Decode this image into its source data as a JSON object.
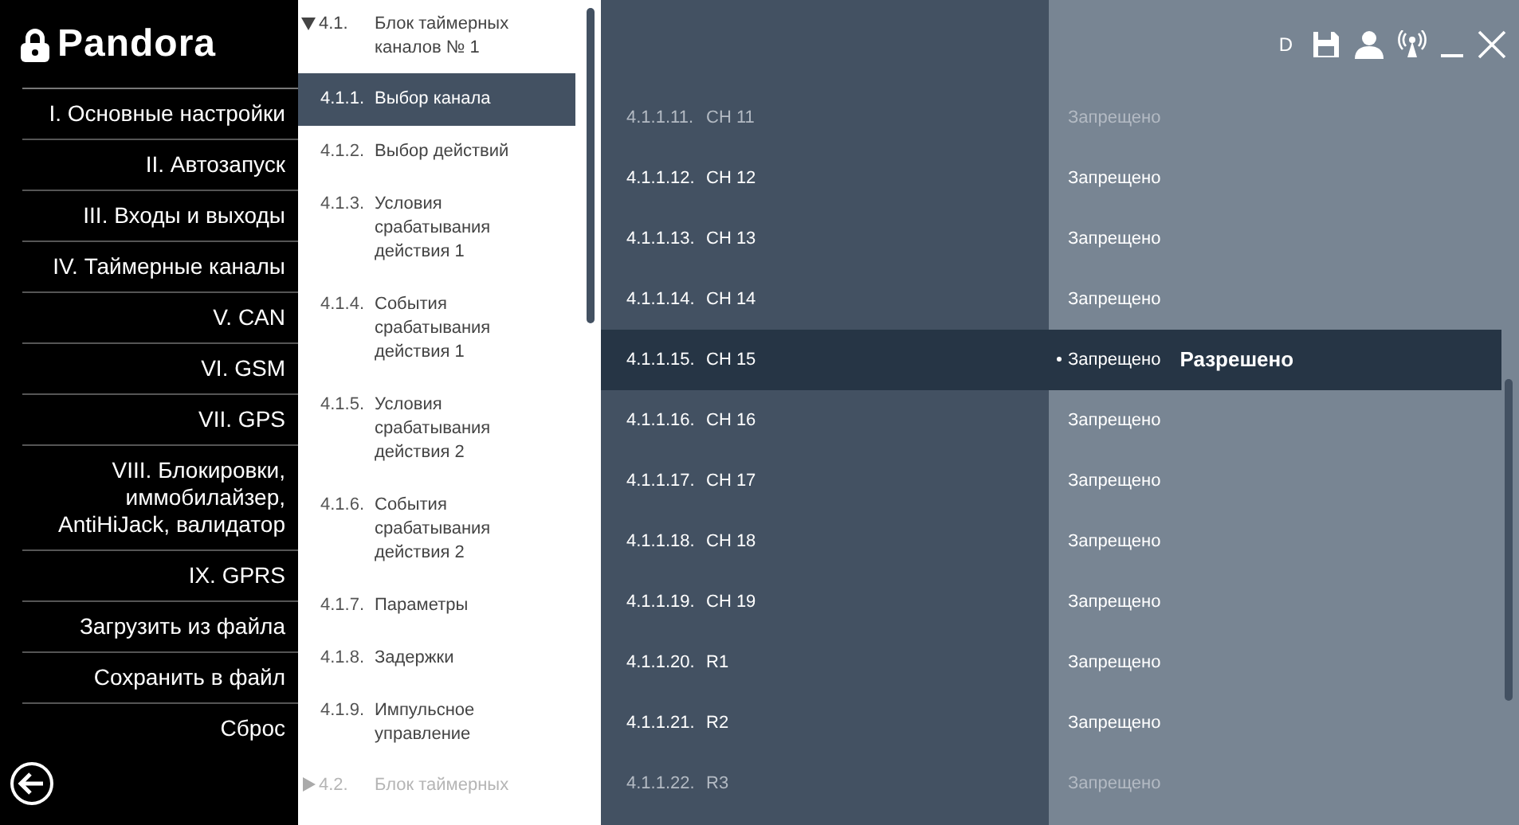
{
  "brand": {
    "name": "Pandora"
  },
  "sidebar": {
    "items": [
      {
        "label": "I. Основные настройки"
      },
      {
        "label": "II. Автозапуск"
      },
      {
        "label": "III. Входы и выходы"
      },
      {
        "label": "IV. Таймерные каналы"
      },
      {
        "label": "V. CAN"
      },
      {
        "label": "VI. GSM"
      },
      {
        "label": "VII. GPS"
      },
      {
        "label": "VIII. Блокировки, иммобилайзер, AntiHiJack, валидатор"
      },
      {
        "label": "IX. GPRS"
      },
      {
        "label": "Загрузить из файла"
      },
      {
        "label": "Сохранить в файл"
      },
      {
        "label": "Сброс"
      }
    ]
  },
  "tree": [
    {
      "number": "4.1.",
      "label": "Блок таймерных каналов № 1",
      "expanded": true,
      "faded": false,
      "children": [
        {
          "number": "4.1.1.",
          "label": "Выбор канала",
          "selected": true
        },
        {
          "number": "4.1.2.",
          "label": "Выбор действий",
          "selected": false
        },
        {
          "number": "4.1.3.",
          "label": "Условия срабатывания действия 1",
          "selected": false
        },
        {
          "number": "4.1.4.",
          "label": "События срабатывания действия 1",
          "selected": false
        },
        {
          "number": "4.1.5.",
          "label": "Условия срабатывания действия 2",
          "selected": false
        },
        {
          "number": "4.1.6.",
          "label": "События срабатывания действия 2",
          "selected": false
        },
        {
          "number": "4.1.7.",
          "label": "Параметры",
          "selected": false
        },
        {
          "number": "4.1.8.",
          "label": "Задержки",
          "selected": false
        },
        {
          "number": "4.1.9.",
          "label": "Импульсное управление",
          "selected": false
        }
      ]
    },
    {
      "number": "4.2.",
      "label": "Блок таймерных",
      "expanded": false,
      "faded": true
    }
  ],
  "title_bar": {
    "mode": "D"
  },
  "channels": [
    {
      "number": "4.1.1.11.",
      "name": "CH 11",
      "value": "Запрещено",
      "selected": false,
      "faded": true
    },
    {
      "number": "4.1.1.12.",
      "name": "CH 12",
      "value": "Запрещено",
      "selected": false,
      "faded": false
    },
    {
      "number": "4.1.1.13.",
      "name": "CH 13",
      "value": "Запрещено",
      "selected": false,
      "faded": false
    },
    {
      "number": "4.1.1.14.",
      "name": "CH 14",
      "value": "Запрещено",
      "selected": false,
      "faded": false
    },
    {
      "number": "4.1.1.15.",
      "name": "CH 15",
      "value": "Запрещено",
      "selected": true,
      "faded": false,
      "option": "Разрешено"
    },
    {
      "number": "4.1.1.16.",
      "name": "CH 16",
      "value": "Запрещено",
      "selected": false,
      "faded": false
    },
    {
      "number": "4.1.1.17.",
      "name": "CH 17",
      "value": "Запрещено",
      "selected": false,
      "faded": false
    },
    {
      "number": "4.1.1.18.",
      "name": "CH 18",
      "value": "Запрещено",
      "selected": false,
      "faded": false
    },
    {
      "number": "4.1.1.19.",
      "name": "CH 19",
      "value": "Запрещено",
      "selected": false,
      "faded": false
    },
    {
      "number": "4.1.1.20.",
      "name": "R1",
      "value": "Запрещено",
      "selected": false,
      "faded": false
    },
    {
      "number": "4.1.1.21.",
      "name": "R2",
      "value": "Запрещено",
      "selected": false,
      "faded": false
    },
    {
      "number": "4.1.1.22.",
      "name": "R3",
      "value": "Запрещено",
      "selected": false,
      "faded": true
    }
  ]
}
